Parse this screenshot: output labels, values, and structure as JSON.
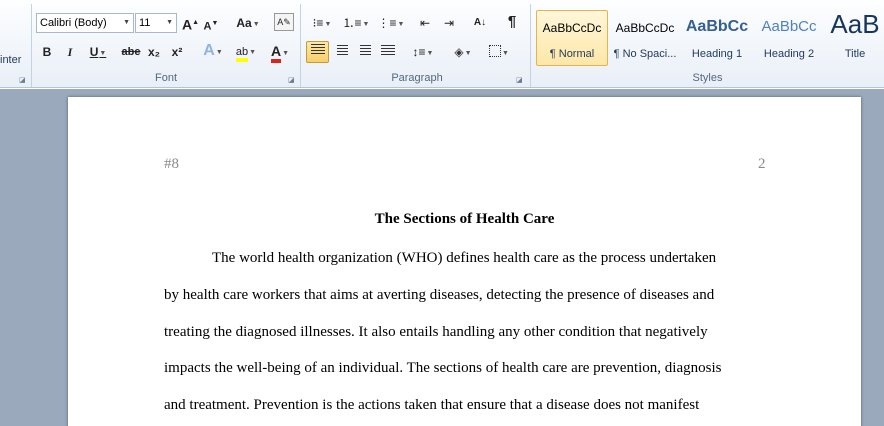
{
  "ribbon": {
    "clipboard": {
      "painter_label": "inter"
    },
    "font": {
      "family": "Calibri (Body)",
      "size": "11",
      "grow_label": "A",
      "shrink_label": "A",
      "change_case_label": "Aa",
      "bold_label": "B",
      "italic_label": "I",
      "underline_label": "U",
      "strikethrough_label": "abe",
      "subscript_label": "x₂",
      "superscript_label": "x²",
      "text_effects_label": "A",
      "highlight_label": "ab",
      "font_color_label": "A",
      "group_label": "Font"
    },
    "paragraph": {
      "show_marks_label": "¶",
      "sort_label": "A↓",
      "group_label": "Paragraph"
    },
    "styles": {
      "items": [
        {
          "sample": "AaBbCcDc",
          "name": "¶ Normal",
          "selected": true
        },
        {
          "sample": "AaBbCcDc",
          "name": "¶ No Spaci...",
          "selected": false
        },
        {
          "sample": "AaBbCc",
          "name": "Heading 1",
          "selected": false
        },
        {
          "sample": "AaBbCc",
          "name": "Heading 2",
          "selected": false
        },
        {
          "sample": "AaB",
          "name": "Title",
          "selected": false
        }
      ],
      "group_label": "Styles"
    },
    "colors": {
      "highlight": "#ffff00",
      "font_color": "#e0201b",
      "selected_accent": "#f8cf6a"
    }
  },
  "document": {
    "header_left": "#8",
    "page_number": "2",
    "title": "The Sections of Health Care",
    "lines": [
      "The world health organization (WHO) defines health care as the process undertaken",
      "by health care workers that aims at averting diseases, detecting the presence of diseases and",
      "treating the diagnosed illnesses.   It also entails handling any other condition that negatively",
      "impacts the well-being of an individual.  The sections of health care are prevention, diagnosis",
      "and treatment. Prevention is the actions taken that ensure that a disease does not manifest"
    ]
  }
}
